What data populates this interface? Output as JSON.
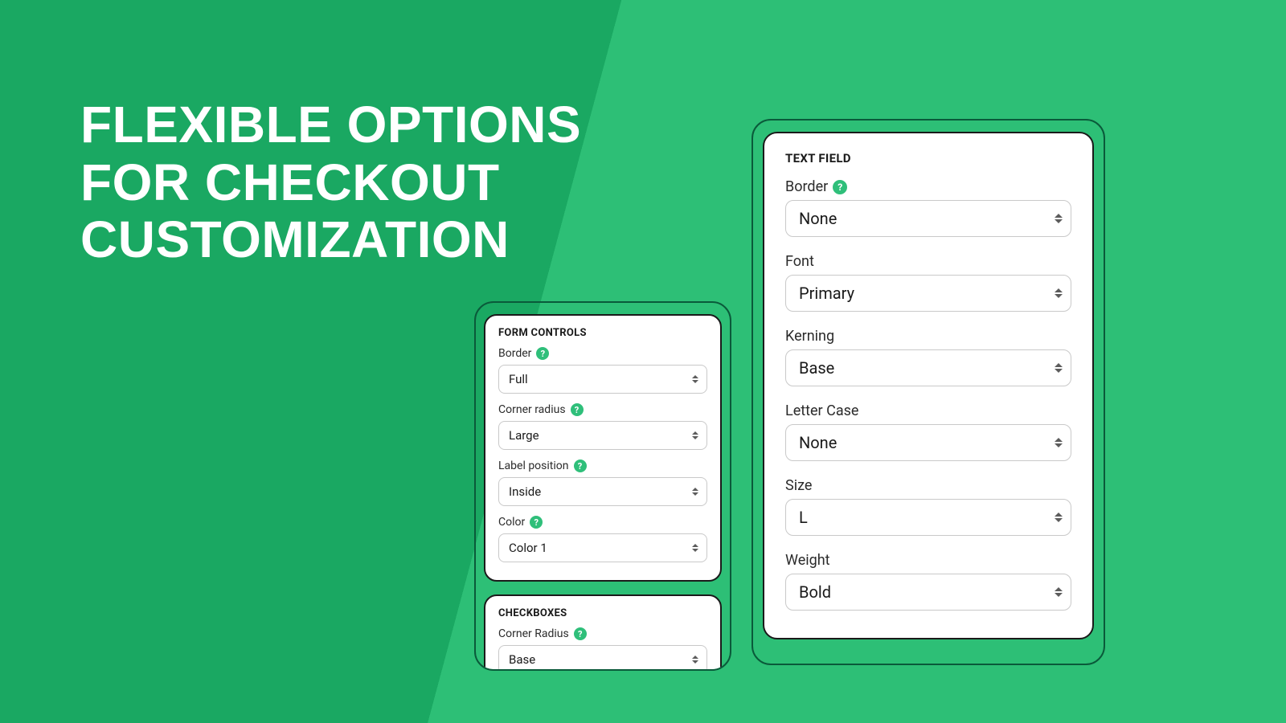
{
  "headline": {
    "line1": "Flexible options",
    "line2": "for checkout",
    "line3": "customization"
  },
  "left": {
    "card1": {
      "title": "FORM CONTROLS",
      "fields": {
        "border": {
          "label": "Border",
          "help": true,
          "value": "Full"
        },
        "radius": {
          "label": "Corner radius",
          "help": true,
          "value": "Large"
        },
        "labelpos": {
          "label": "Label position",
          "help": true,
          "value": "Inside"
        },
        "color": {
          "label": "Color",
          "help": true,
          "value": "Color 1"
        }
      }
    },
    "card2": {
      "title": "CHECKBOXES",
      "fields": {
        "radius": {
          "label": "Corner Radius",
          "help": true,
          "value": "Base"
        }
      }
    }
  },
  "right": {
    "card1": {
      "title": "TEXT FIELD",
      "fields": {
        "border": {
          "label": "Border",
          "help": true,
          "value": "None"
        },
        "font": {
          "label": "Font",
          "help": false,
          "value": "Primary"
        },
        "kerning": {
          "label": "Kerning",
          "help": false,
          "value": "Base"
        },
        "case": {
          "label": "Letter Case",
          "help": false,
          "value": "None"
        },
        "size": {
          "label": "Size",
          "help": false,
          "value": "L"
        },
        "weight": {
          "label": "Weight",
          "help": false,
          "value": "Bold"
        }
      }
    }
  }
}
